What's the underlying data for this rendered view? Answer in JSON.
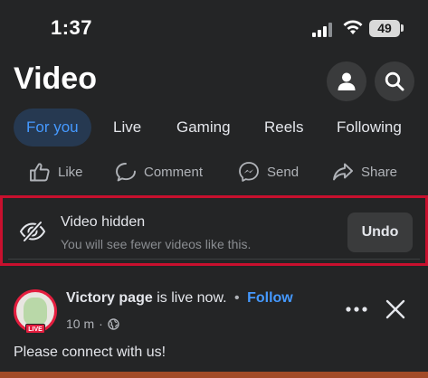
{
  "status_bar": {
    "time": "1:37",
    "battery": "49",
    "icons": [
      "cellular-signal-icon",
      "wifi-icon",
      "battery-icon"
    ]
  },
  "header": {
    "title": "Video",
    "profile_icon": "person-icon",
    "search_icon": "search-icon"
  },
  "tabs": [
    {
      "label": "For you",
      "active": true
    },
    {
      "label": "Live",
      "active": false
    },
    {
      "label": "Gaming",
      "active": false
    },
    {
      "label": "Reels",
      "active": false
    },
    {
      "label": "Following",
      "active": false
    }
  ],
  "actions": {
    "like": "Like",
    "comment": "Comment",
    "send": "Send",
    "share": "Share"
  },
  "hidden_notice": {
    "title": "Video hidden",
    "subtitle": "You will see fewer videos like this.",
    "undo": "Undo",
    "icon": "eye-slash-icon"
  },
  "post": {
    "author": "Victory page",
    "status": "is live now.",
    "follow": "Follow",
    "separator": "•",
    "time": "10 m",
    "audience_icon": "globe-icon",
    "live_badge": "LIVE",
    "text": "Please connect with us!"
  },
  "colors": {
    "background": "#242526",
    "accent": "#4599ff",
    "highlight_border": "#c8102e",
    "live_red": "#e41e3f"
  }
}
